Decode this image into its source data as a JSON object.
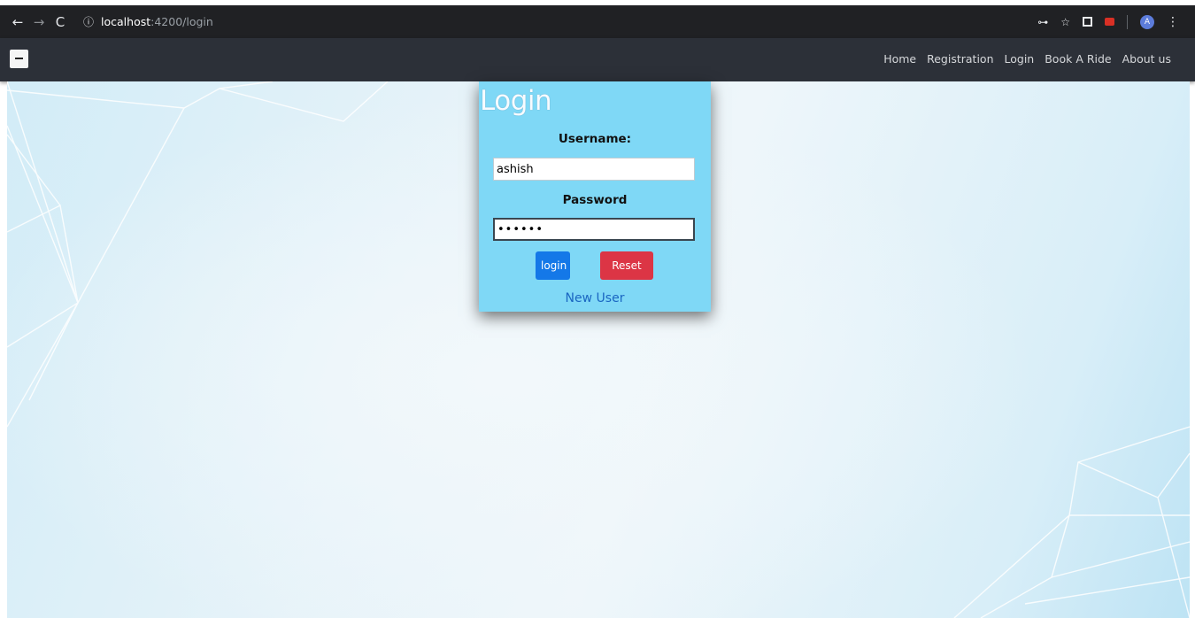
{
  "browser": {
    "back": "←",
    "forward": "→",
    "reload": "C",
    "info_icon": "ⓘ",
    "url_host": "localhost",
    "url_path": ":4200/login",
    "key_icon": "⊶",
    "star_icon": "☆",
    "avatar_letter": "A",
    "menu_icon": "⋮"
  },
  "navbar": {
    "links": [
      "Home",
      "Registration",
      "Login",
      "Book A Ride",
      "About us"
    ]
  },
  "login": {
    "title": "Login",
    "username_label": "Username:",
    "username_value": "ashish",
    "password_label": "Password",
    "password_value": "••••••",
    "login_button": "login",
    "reset_button": "Reset",
    "new_user_link": "New User"
  },
  "colors": {
    "card_bg": "#7fd8f6",
    "login_button": "#1478e8",
    "reset_button": "#dc3545",
    "link": "#1a66c2",
    "navbar_bg": "#2c3038"
  }
}
